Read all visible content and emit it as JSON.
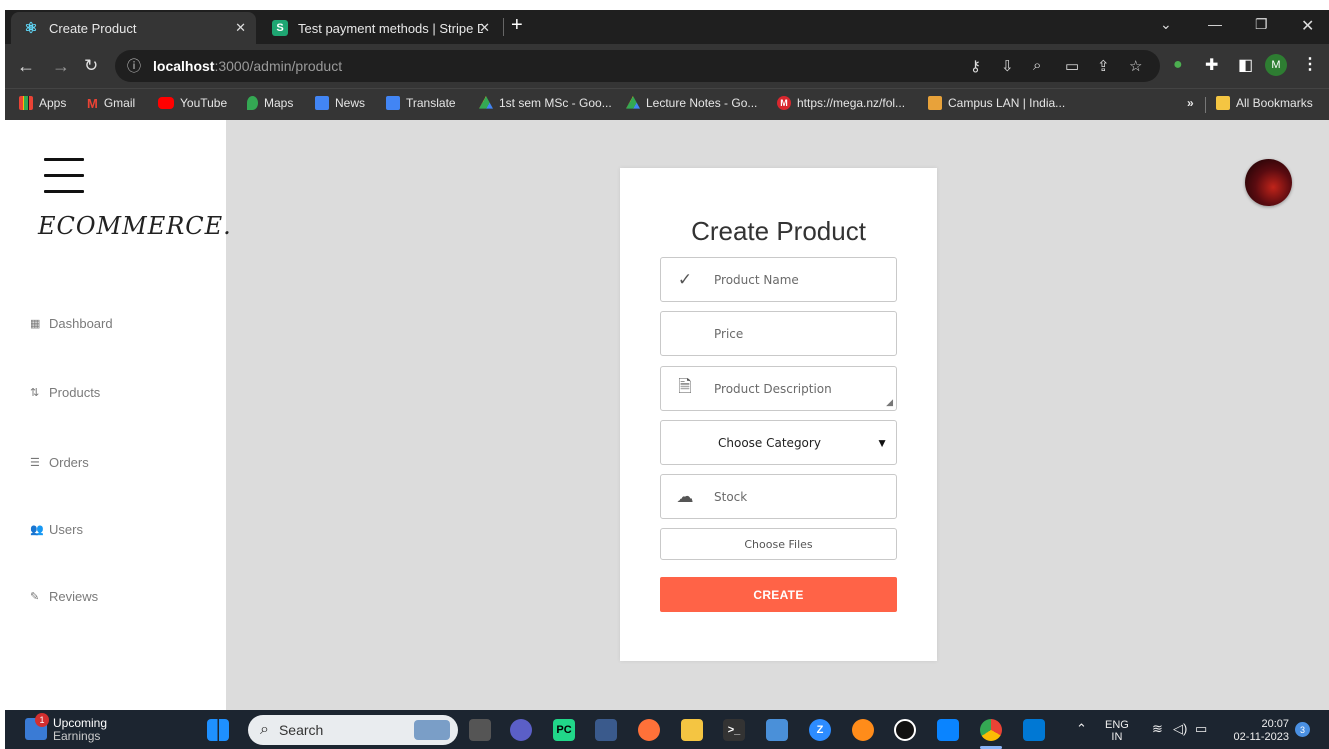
{
  "browser": {
    "tabs": [
      {
        "title": "Create Product",
        "active": true
      },
      {
        "title": "Test payment methods | Stripe D",
        "active": false
      }
    ],
    "url_host": "localhost",
    "url_rest": ":3000/admin/product",
    "profile_initial": "M",
    "bookmarks": [
      "Apps",
      "Gmail",
      "YouTube",
      "Maps",
      "News",
      "Translate",
      "1st sem MSc - Goo...",
      "Lecture Notes - Go...",
      "https://mega.nz/fol...",
      "Campus LAN | India..."
    ],
    "all_bookmarks_label": "All Bookmarks",
    "overflow_label": "»"
  },
  "sidebar": {
    "logo": "ECOMMERCE.",
    "items": [
      {
        "label": "Dashboard",
        "icon": "grid-icon"
      },
      {
        "label": "Products",
        "icon": "sort-icon"
      },
      {
        "label": "Orders",
        "icon": "list-icon"
      },
      {
        "label": "Users",
        "icon": "users-icon"
      },
      {
        "label": "Reviews",
        "icon": "review-icon"
      }
    ]
  },
  "form": {
    "title": "Create Product",
    "name_placeholder": "Product Name",
    "price_placeholder": "Price",
    "description_placeholder": "Product Description",
    "category_placeholder": "Choose Category",
    "stock_placeholder": "Stock",
    "files_label": "Choose Files",
    "submit_label": "CREATE"
  },
  "taskbar": {
    "widget_title": "Upcoming",
    "widget_subtitle": "Earnings",
    "widget_badge": "1",
    "search_label": "Search",
    "lang_top": "ENG",
    "lang_bottom": "IN",
    "time": "20:07",
    "date": "02-11-2023",
    "notification_count": "3"
  },
  "colors": {
    "accent": "#ff6347",
    "page_bg": "#dcdcdc",
    "chrome_dark": "#1f1f1f"
  }
}
